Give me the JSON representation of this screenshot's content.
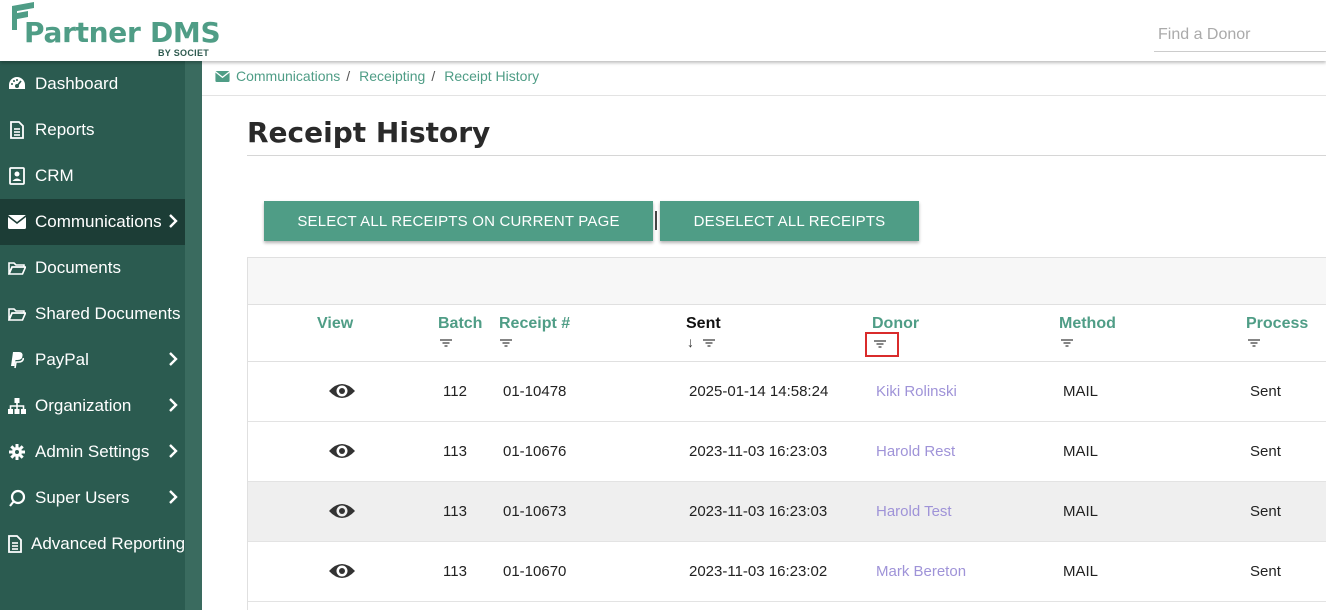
{
  "app": {
    "logo_text": "Partner DMS",
    "logo_sub": "BY SOCIET",
    "search_placeholder": "Find a Donor"
  },
  "sidebar": {
    "items": [
      {
        "label": "Dashboard",
        "icon": "dashboard-icon",
        "chevron": false,
        "active": false
      },
      {
        "label": "Reports",
        "icon": "report-icon",
        "chevron": false,
        "active": false
      },
      {
        "label": "CRM",
        "icon": "contact-icon",
        "chevron": false,
        "active": false
      },
      {
        "label": "Communications",
        "icon": "envelope-icon",
        "chevron": true,
        "active": true
      },
      {
        "label": "Documents",
        "icon": "folder-icon",
        "chevron": false,
        "active": false
      },
      {
        "label": "Shared Documents",
        "icon": "folder-icon",
        "chevron": false,
        "active": false
      },
      {
        "label": "PayPal",
        "icon": "paypal-icon",
        "chevron": true,
        "active": false
      },
      {
        "label": "Organization",
        "icon": "sitemap-icon",
        "chevron": true,
        "active": false
      },
      {
        "label": "Admin Settings",
        "icon": "gear-icon",
        "chevron": true,
        "active": false
      },
      {
        "label": "Super Users",
        "icon": "super-user-icon",
        "chevron": true,
        "active": false
      },
      {
        "label": "Advanced Reporting",
        "icon": "report-icon",
        "chevron": false,
        "active": false
      }
    ]
  },
  "breadcrumb": {
    "items": [
      "Communications",
      "Receipting",
      "Receipt History"
    ],
    "separator": "/"
  },
  "page": {
    "title": "Receipt History"
  },
  "buttons": {
    "select_all": "SELECT ALL RECEIPTS ON CURRENT PAGE",
    "deselect_all": "DESELECT ALL RECEIPTS"
  },
  "table": {
    "columns": [
      "View",
      "Batch",
      "Receipt #",
      "Sent",
      "Donor",
      "Method",
      "Process"
    ],
    "sort_indicator": "↓",
    "rows": [
      {
        "batch": "112",
        "receipt": "01-10478",
        "sent": "2025-01-14 14:58:24",
        "donor": "Kiki Rolinski",
        "method": "MAIL",
        "process": "Sent"
      },
      {
        "batch": "113",
        "receipt": "01-10676",
        "sent": "2023-11-03 16:23:03",
        "donor": "Harold Rest",
        "method": "MAIL",
        "process": "Sent"
      },
      {
        "batch": "113",
        "receipt": "01-10673",
        "sent": "2023-11-03 16:23:03",
        "donor": "Harold Test",
        "method": "MAIL",
        "process": "Sent"
      },
      {
        "batch": "113",
        "receipt": "01-10670",
        "sent": "2023-11-03 16:23:02",
        "donor": "Mark Bereton",
        "method": "MAIL",
        "process": "Sent"
      }
    ]
  },
  "colors": {
    "brand_green": "#4f9d86",
    "sidebar_bg": "#2b5b50",
    "sidebar_active": "#1c3d36",
    "donor_link": "#9f93d8",
    "highlight_red": "#d92b2b"
  }
}
